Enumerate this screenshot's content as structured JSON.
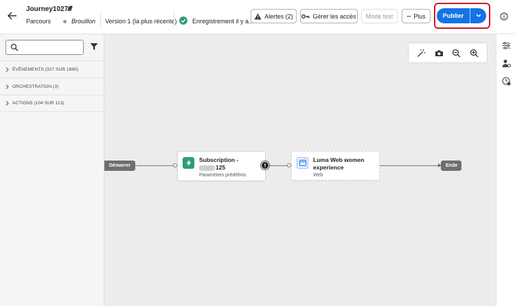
{
  "header": {
    "journey_name": "Journey10270",
    "breadcrumb": "Parcours",
    "status": "Brouillon",
    "version": "Version 1 (la plus récente)",
    "save_status": "Enregistrement il y a...",
    "alerts_label": "Alertes (2)",
    "access_label": "Gérer les accès",
    "test_mode_label": "Mode test",
    "more_label": "Plus",
    "publish_label": "Publier",
    "publish_color": "#1473e6",
    "highlight_color": "#d3122b"
  },
  "left_panel": {
    "search_placeholder": "",
    "sections": [
      {
        "label": "ÉVÉNEMENTS (327 SUR 1860)"
      },
      {
        "label": "ORCHESTRATION (3)"
      },
      {
        "label": "ACTIONS (104 SUR 113)"
      }
    ]
  },
  "canvas": {
    "start_label": "Démarrer",
    "end_label": "Ende",
    "node1": {
      "title_line1": "Subscription -",
      "title_line2": "125",
      "subtitle": "Paramètres prédéfinis",
      "icon": "event-icon",
      "icon_color": "#2d9d78"
    },
    "node2": {
      "title_line1": "Luma Web women",
      "title_line2": "experience",
      "subtitle": "Web",
      "icon": "web-icon",
      "icon_color": "#1473e6"
    }
  }
}
